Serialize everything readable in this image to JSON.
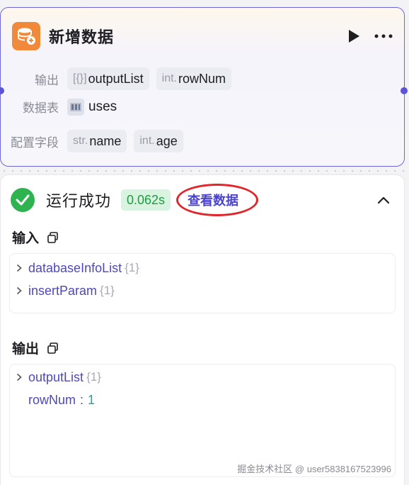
{
  "node": {
    "title": "新增数据",
    "icon": "database-add-icon",
    "accent_color": "#f08a3a",
    "border_color": "#6e68d6",
    "fields": {
      "output_label": "输出",
      "output_tags": [
        {
          "type": "[{}]",
          "name": "outputList"
        },
        {
          "type": "int.",
          "name": "rowNum"
        }
      ],
      "table_label": "数据表",
      "table_value": "uses",
      "config_label": "配置字段",
      "config_tags": [
        {
          "type": "str.",
          "name": "name"
        },
        {
          "type": "int.",
          "name": "age"
        }
      ]
    }
  },
  "result": {
    "status_text": "运行成功",
    "status_color": "#2fb351",
    "duration": "0.062s",
    "view_data_label": "查看数据",
    "input_title": "输入",
    "input_items": [
      {
        "key": "databaseInfoList",
        "count": "{1}"
      },
      {
        "key": "insertParam",
        "count": "{1}"
      }
    ],
    "output_title": "输出",
    "output_items": [
      {
        "key": "outputList",
        "count": "{1}"
      },
      {
        "key": "rowNum",
        "sep": ":",
        "value": "1"
      }
    ]
  },
  "watermark": "掘金技术社区 @ user5838167523996"
}
